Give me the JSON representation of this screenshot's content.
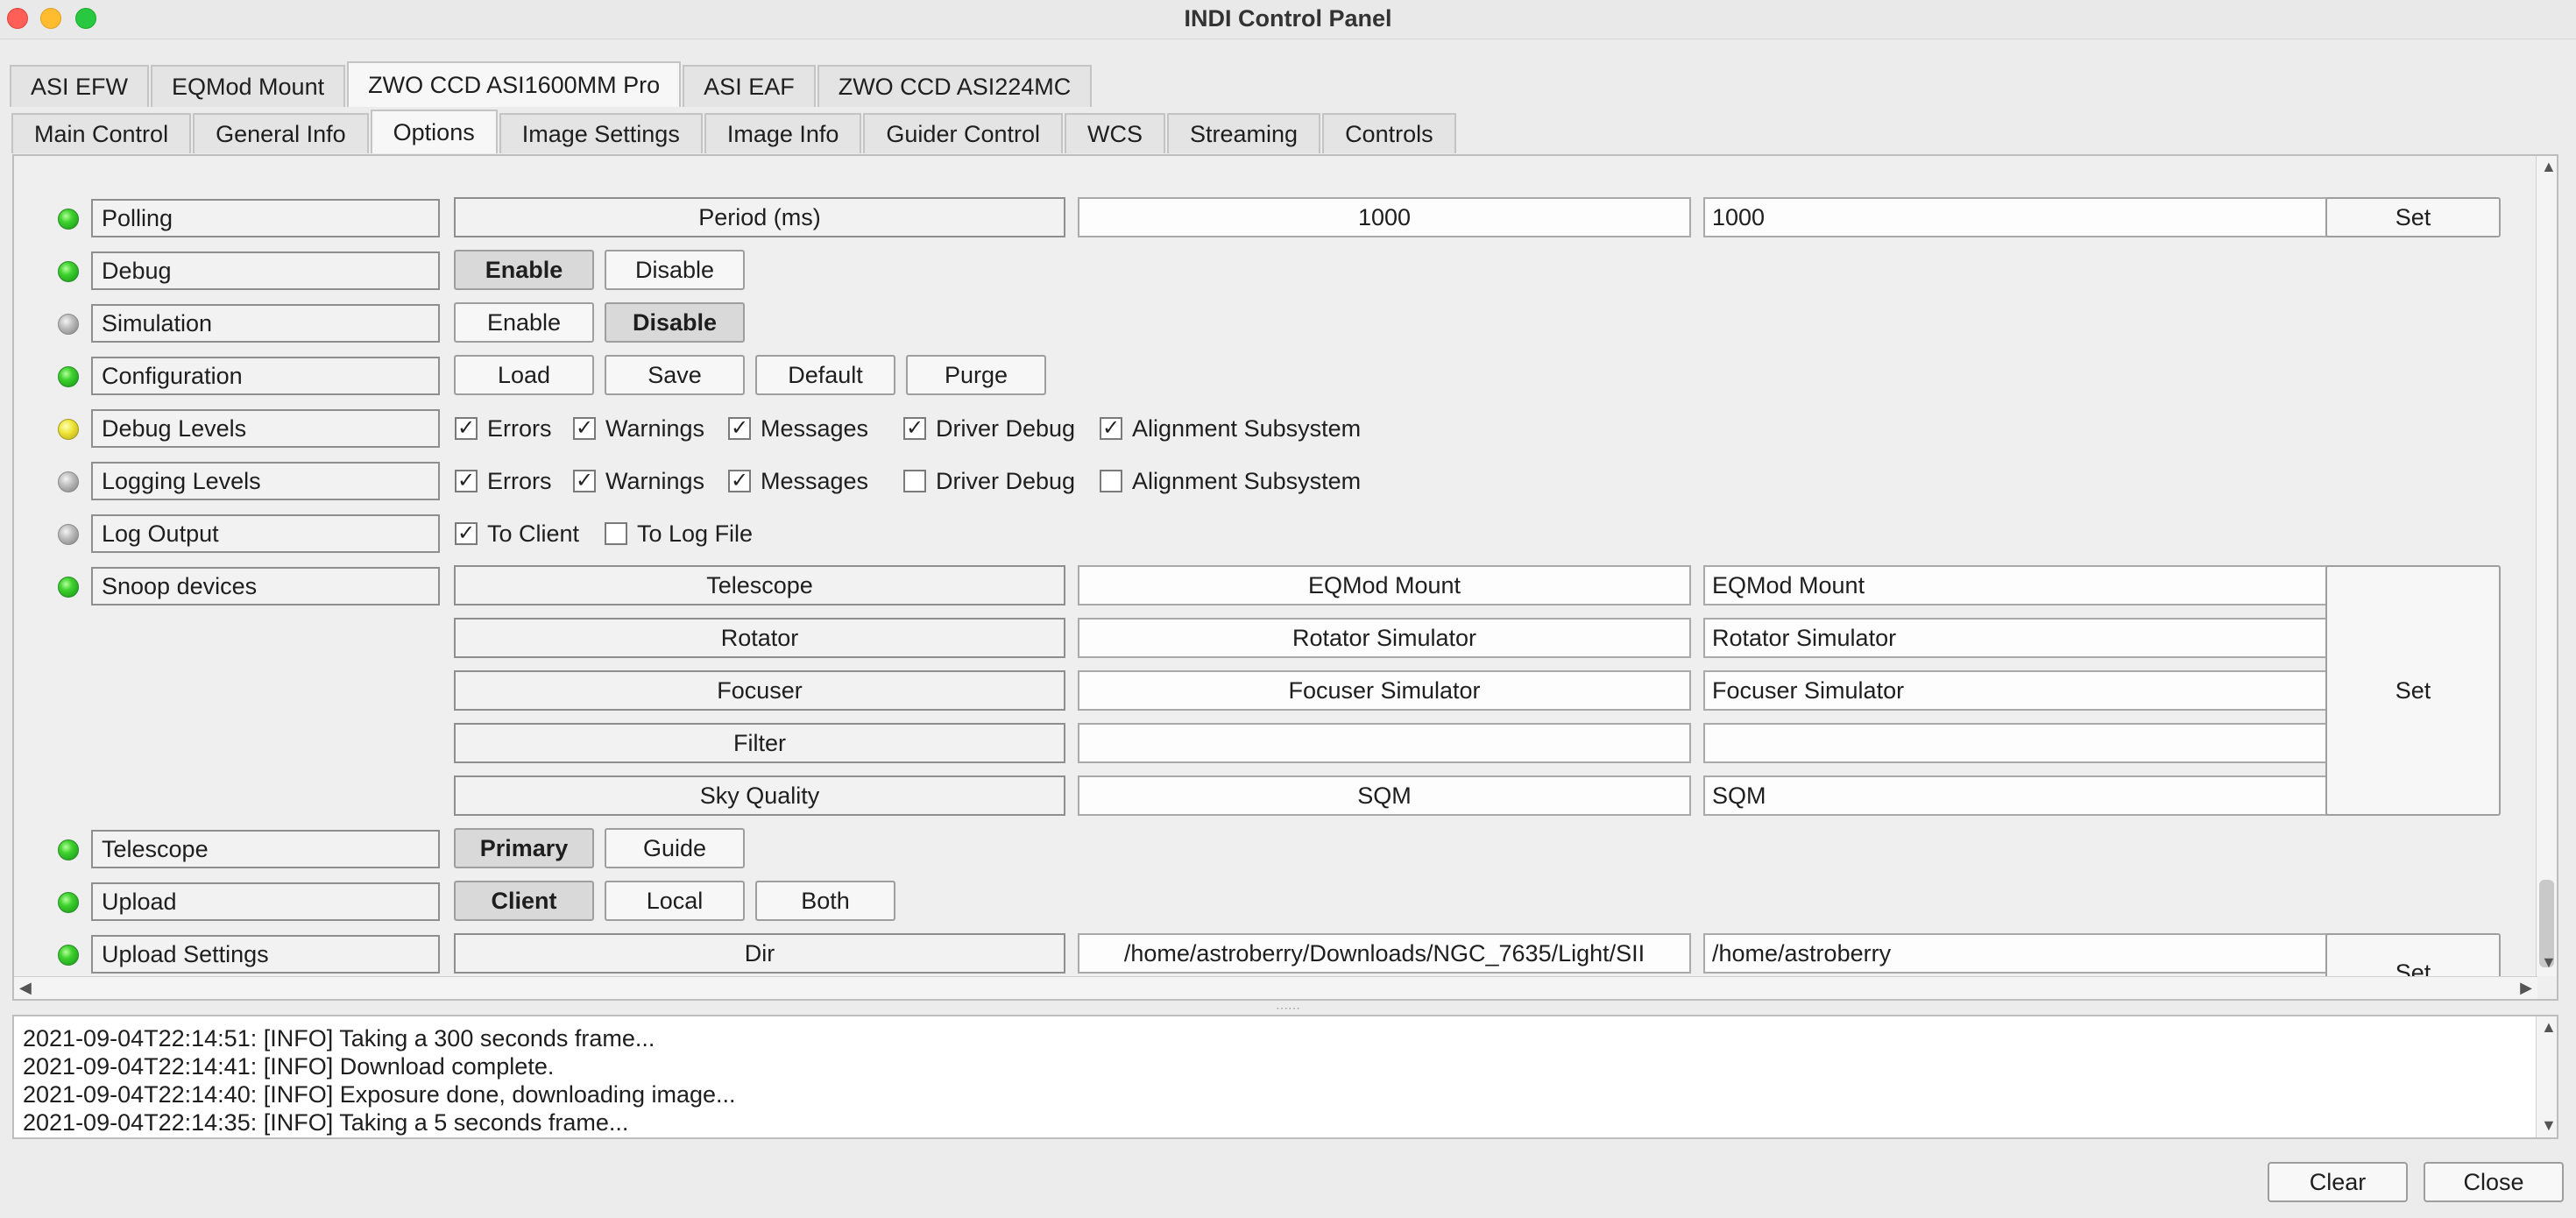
{
  "window": {
    "title": "INDI Control Panel"
  },
  "device_tabs": [
    "ASI EFW",
    "EQMod Mount",
    "ZWO CCD ASI1600MM Pro",
    "ASI EAF",
    "ZWO CCD ASI224MC"
  ],
  "group_tabs": [
    "Main Control",
    "General Info",
    "Options",
    "Image Settings",
    "Image Info",
    "Guider Control",
    "WCS",
    "Streaming",
    "Controls"
  ],
  "selected_device_tab": "ZWO CCD ASI1600MM Pro",
  "selected_group_tab": "Options",
  "properties": {
    "polling": {
      "label": "Polling",
      "state": "ok",
      "element": "Period (ms)",
      "value": "1000",
      "input": "1000",
      "set": "Set"
    },
    "debug": {
      "label": "Debug",
      "state": "ok",
      "enable": "Enable",
      "disable": "Disable",
      "active": "Enable"
    },
    "simulation": {
      "label": "Simulation",
      "state": "idle",
      "enable": "Enable",
      "disable": "Disable",
      "active": "Disable"
    },
    "configuration": {
      "label": "Configuration",
      "state": "ok",
      "load": "Load",
      "save": "Save",
      "default": "Default",
      "purge": "Purge"
    },
    "debug_levels": {
      "label": "Debug Levels",
      "state": "busy",
      "errors": "Errors",
      "warnings": "Warnings",
      "messages": "Messages",
      "driver_debug": "Driver Debug",
      "alignment": "Alignment Subsystem",
      "checked": [
        true,
        true,
        true,
        true,
        true
      ]
    },
    "logging_levels": {
      "label": "Logging Levels",
      "state": "idle",
      "errors": "Errors",
      "warnings": "Warnings",
      "messages": "Messages",
      "driver_debug": "Driver Debug",
      "alignment": "Alignment Subsystem",
      "checked": [
        true,
        true,
        true,
        false,
        false
      ]
    },
    "log_output": {
      "label": "Log Output",
      "state": "idle",
      "to_client": "To Client",
      "to_log_file": "To Log File",
      "checked": [
        true,
        false
      ]
    },
    "snoop_devices": {
      "label": "Snoop devices",
      "state": "ok",
      "set": "Set",
      "rows": [
        {
          "name": "Telescope",
          "value": "EQMod Mount",
          "input": "EQMod Mount"
        },
        {
          "name": "Rotator",
          "value": "Rotator Simulator",
          "input": "Rotator Simulator"
        },
        {
          "name": "Focuser",
          "value": "Focuser Simulator",
          "input": "Focuser Simulator"
        },
        {
          "name": "Filter",
          "value": "",
          "input": ""
        },
        {
          "name": "Sky Quality",
          "value": "SQM",
          "input": "SQM"
        }
      ]
    },
    "telescope": {
      "label": "Telescope",
      "state": "ok",
      "primary": "Primary",
      "guide": "Guide",
      "active": "Primary"
    },
    "upload": {
      "label": "Upload",
      "state": "ok",
      "client": "Client",
      "local": "Local",
      "both": "Both",
      "active": "Client"
    },
    "upload_settings": {
      "label": "Upload Settings",
      "state": "ok",
      "element": "Dir",
      "value": "/home/astroberry/Downloads/NGC_7635/Light/SII",
      "input": "/home/astroberry",
      "set": "Set"
    }
  },
  "log": [
    "2021-09-04T22:14:51: [INFO] Taking a 300 seconds frame...",
    "2021-09-04T22:14:41: [INFO] Download complete.",
    "2021-09-04T22:14:40: [INFO] Exposure done, downloading image...",
    "2021-09-04T22:14:35: [INFO] Taking a 5 seconds frame..."
  ],
  "footer": {
    "clear": "Clear",
    "close": "Close"
  }
}
